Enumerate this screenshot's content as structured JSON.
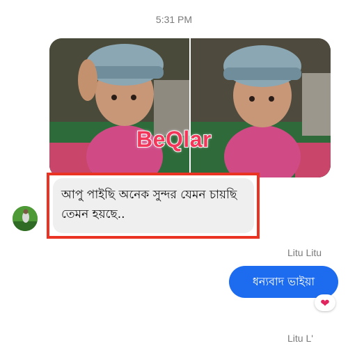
{
  "conversation": {
    "timestamp": "5:31 PM",
    "watermark": "BeQlar",
    "incoming_message": "আপু পাইছি অনেক সুন্দর যেমন চায়ছি তেমন হয়ছে..",
    "sender_name": "Litu Litu",
    "outgoing_message": "ধন্যবাদ ভাইয়া",
    "reaction_icon": "heart-icon",
    "reaction_glyph": "❤",
    "sender_name_partial": "Litu L'"
  },
  "colors": {
    "outgoing_bubble": "#1d6cf0",
    "incoming_bubble": "#efefef",
    "highlight_border": "#ea3323",
    "watermark": "#f2375b"
  }
}
